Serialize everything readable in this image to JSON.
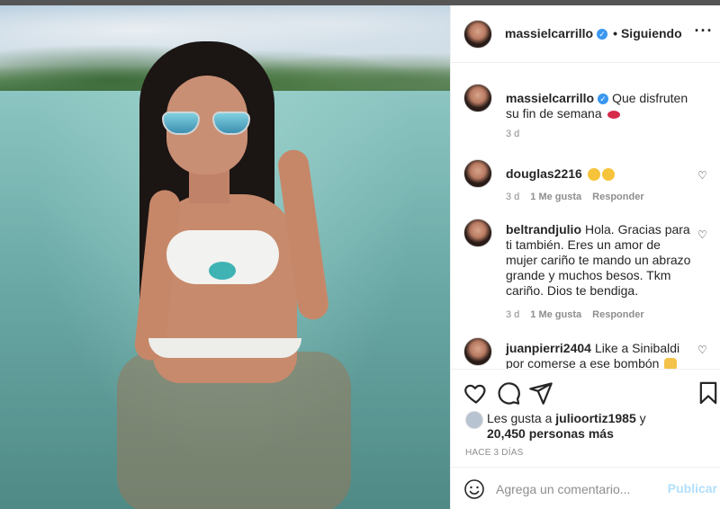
{
  "post": {
    "author": "massielcarrillo",
    "verified": true,
    "follow_status": "Siguiendo",
    "caption": "Que disfruten su fin de semana",
    "caption_time": "3 d"
  },
  "comments": [
    {
      "user": "douglas2216",
      "text": "",
      "time": "3 d",
      "likes": "1 Me gusta",
      "reply": "Responder"
    },
    {
      "user": "beltrandjulio",
      "text": "Hola. Gracias para ti también. Eres un amor de mujer cariño te mando un abrazo grande y muchos besos. Tkm cariño. Dios te bendiga.",
      "time": "3 d",
      "likes": "1 Me gusta",
      "reply": "Responder"
    },
    {
      "user": "juanpierri2404",
      "text": "Like a Sinibaldi por comerse a ese bombón"
    }
  ],
  "likes": {
    "prefix": "Les gusta a",
    "liker": "julioortiz1985",
    "connector": "y",
    "others": "20,450 personas más"
  },
  "time_ago": "HACE 3 DÍAS",
  "comment_box": {
    "placeholder": "Agrega un comentario...",
    "publish_label": "Publicar"
  },
  "icons": {
    "more": "more-options-icon",
    "like": "heart-icon",
    "comment": "comment-icon",
    "share": "share-icon",
    "save": "bookmark-icon",
    "emoji": "smiley-icon"
  },
  "colors": {
    "verified_blue": "#3897f0",
    "publish_disabled": "#b2dffc",
    "muted_text": "#8e8e8e"
  }
}
